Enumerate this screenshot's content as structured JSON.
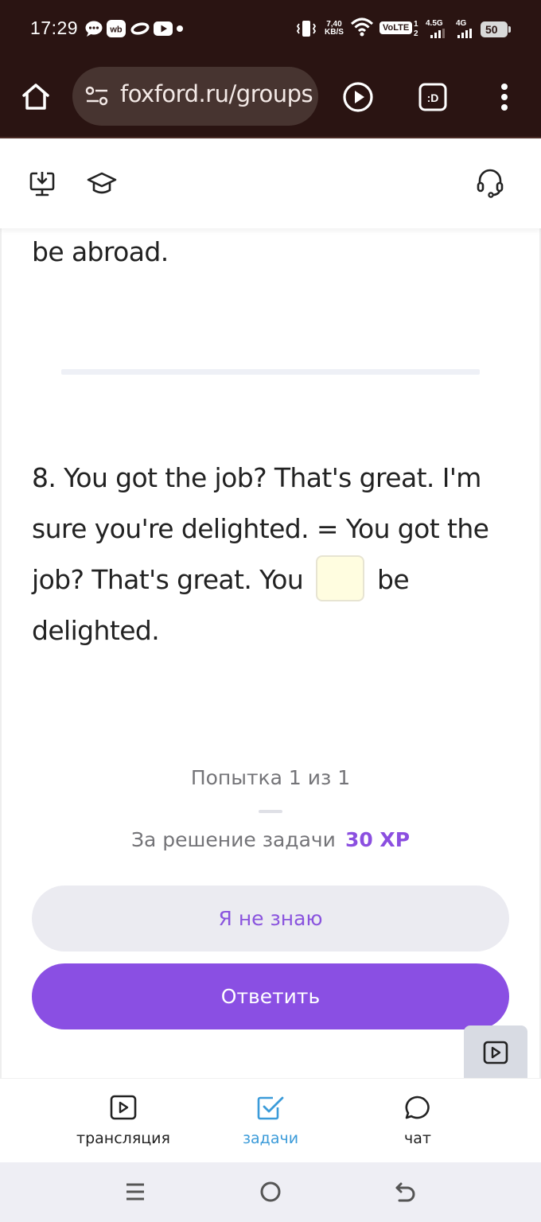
{
  "status_bar": {
    "time": "17:29",
    "net_speed_value": "7,40",
    "net_speed_unit": "KB/S",
    "volte": "VoLTE",
    "sim_marks": [
      "1",
      "2"
    ],
    "signal_1_label": "4.5G",
    "signal_2_label": "4G",
    "battery": "50",
    "notification_icons": [
      "chat-bubble-icon",
      "wb-app-icon",
      "ring-icon",
      "youtube-icon",
      "dot-icon"
    ],
    "indicator_icons": [
      "vibrate-icon",
      "wifi-icon"
    ]
  },
  "browser": {
    "url": "foxford.ru/groups",
    "icons": [
      "home-icon",
      "site-settings-icon",
      "play-circle-icon",
      "tab-switcher-icon",
      "more-menu-icon"
    ],
    "tab_switcher_label": ":D"
  },
  "site_header": {
    "icons": [
      "download-monitor-icon",
      "graduation-cap-icon",
      "headset-support-icon"
    ]
  },
  "task": {
    "previous_tail": "be abroad.",
    "question_part1": "8. You got the job? That's great. I'm sure you're delighted. = You got the job? That's great. You",
    "question_part2": "be delighted.",
    "answer_value": "",
    "attempt_text": "Попытка 1 из 1",
    "reward_label": "За решение задачи",
    "reward_xp": "30 XP",
    "dont_know_button": "Я не знаю",
    "answer_button": "Ответить"
  },
  "bottom_nav": {
    "items": [
      {
        "label": "трансляция",
        "icon": "play-square-icon",
        "active": false
      },
      {
        "label": "задачи",
        "icon": "checkbox-icon",
        "active": true
      },
      {
        "label": "чат",
        "icon": "chat-icon",
        "active": false
      }
    ]
  },
  "system_nav": {
    "buttons": [
      "menu-icon",
      "home-circle-icon",
      "back-icon"
    ]
  },
  "colors": {
    "browser_bg": "#2a1412",
    "accent_purple": "#8a4fe3",
    "active_tab_blue": "#3b9bd9",
    "input_bg": "#fffde0"
  }
}
